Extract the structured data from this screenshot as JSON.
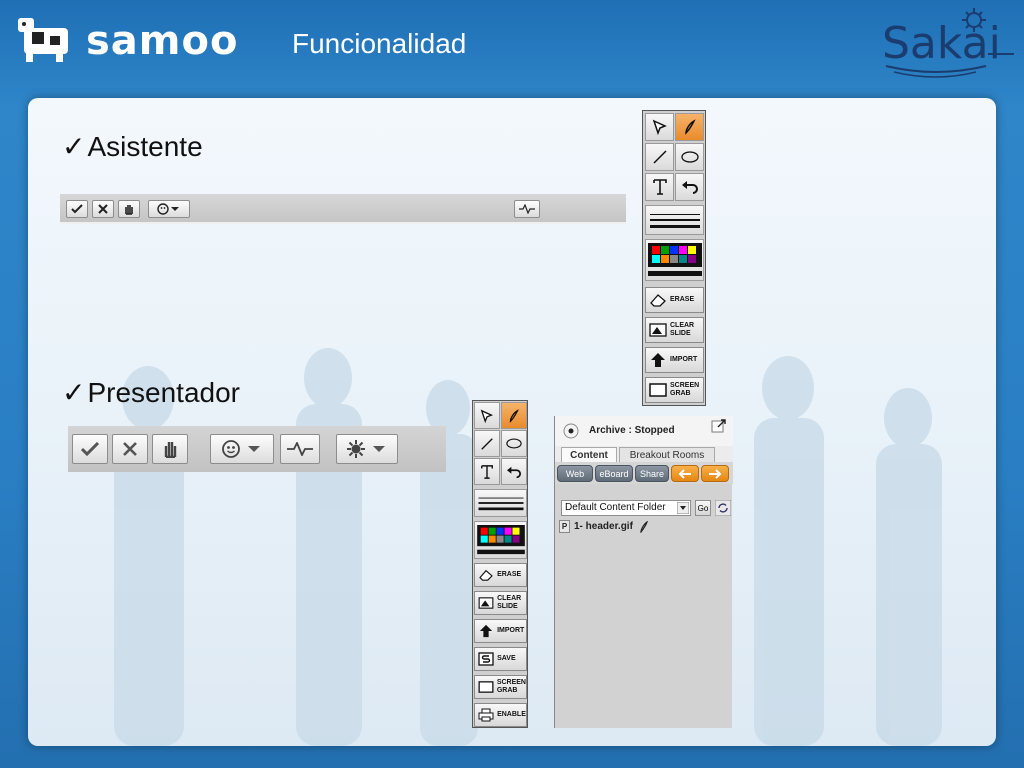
{
  "header": {
    "brand": "samoo",
    "title": "Funcionalidad",
    "partner_brand": "Sakai"
  },
  "sections": {
    "asistente": "Asistente",
    "presentador": "Presentador",
    "check_glyph": "✓"
  },
  "whiteboard": {
    "buttons": {
      "erase": "ERASE",
      "clear_slide": "CLEAR SLIDE",
      "import": "IMPORT",
      "save": "SAVE",
      "screen_grab": "SCREEN GRAB",
      "enable": "ENABLE"
    },
    "palette": [
      "#ff0000",
      "#00a000",
      "#0033ff",
      "#ffff00",
      "#ff00ff",
      "#00ffff",
      "#ff8800",
      "#000000",
      "#ffffff",
      "#888888",
      "#008888",
      "#880088"
    ]
  },
  "content_panel": {
    "status": "Archive : Stopped",
    "tabs": [
      "Content",
      "Breakout Rooms"
    ],
    "buttons": [
      "Web",
      "eBoard",
      "Share"
    ],
    "folder": "Default Content Folder",
    "go_label": "Go",
    "file": "1- header.gif",
    "file_prefix": "P"
  },
  "colors": {
    "accent_orange": "#e98b2b",
    "background_blue": "#2a7fc4"
  }
}
